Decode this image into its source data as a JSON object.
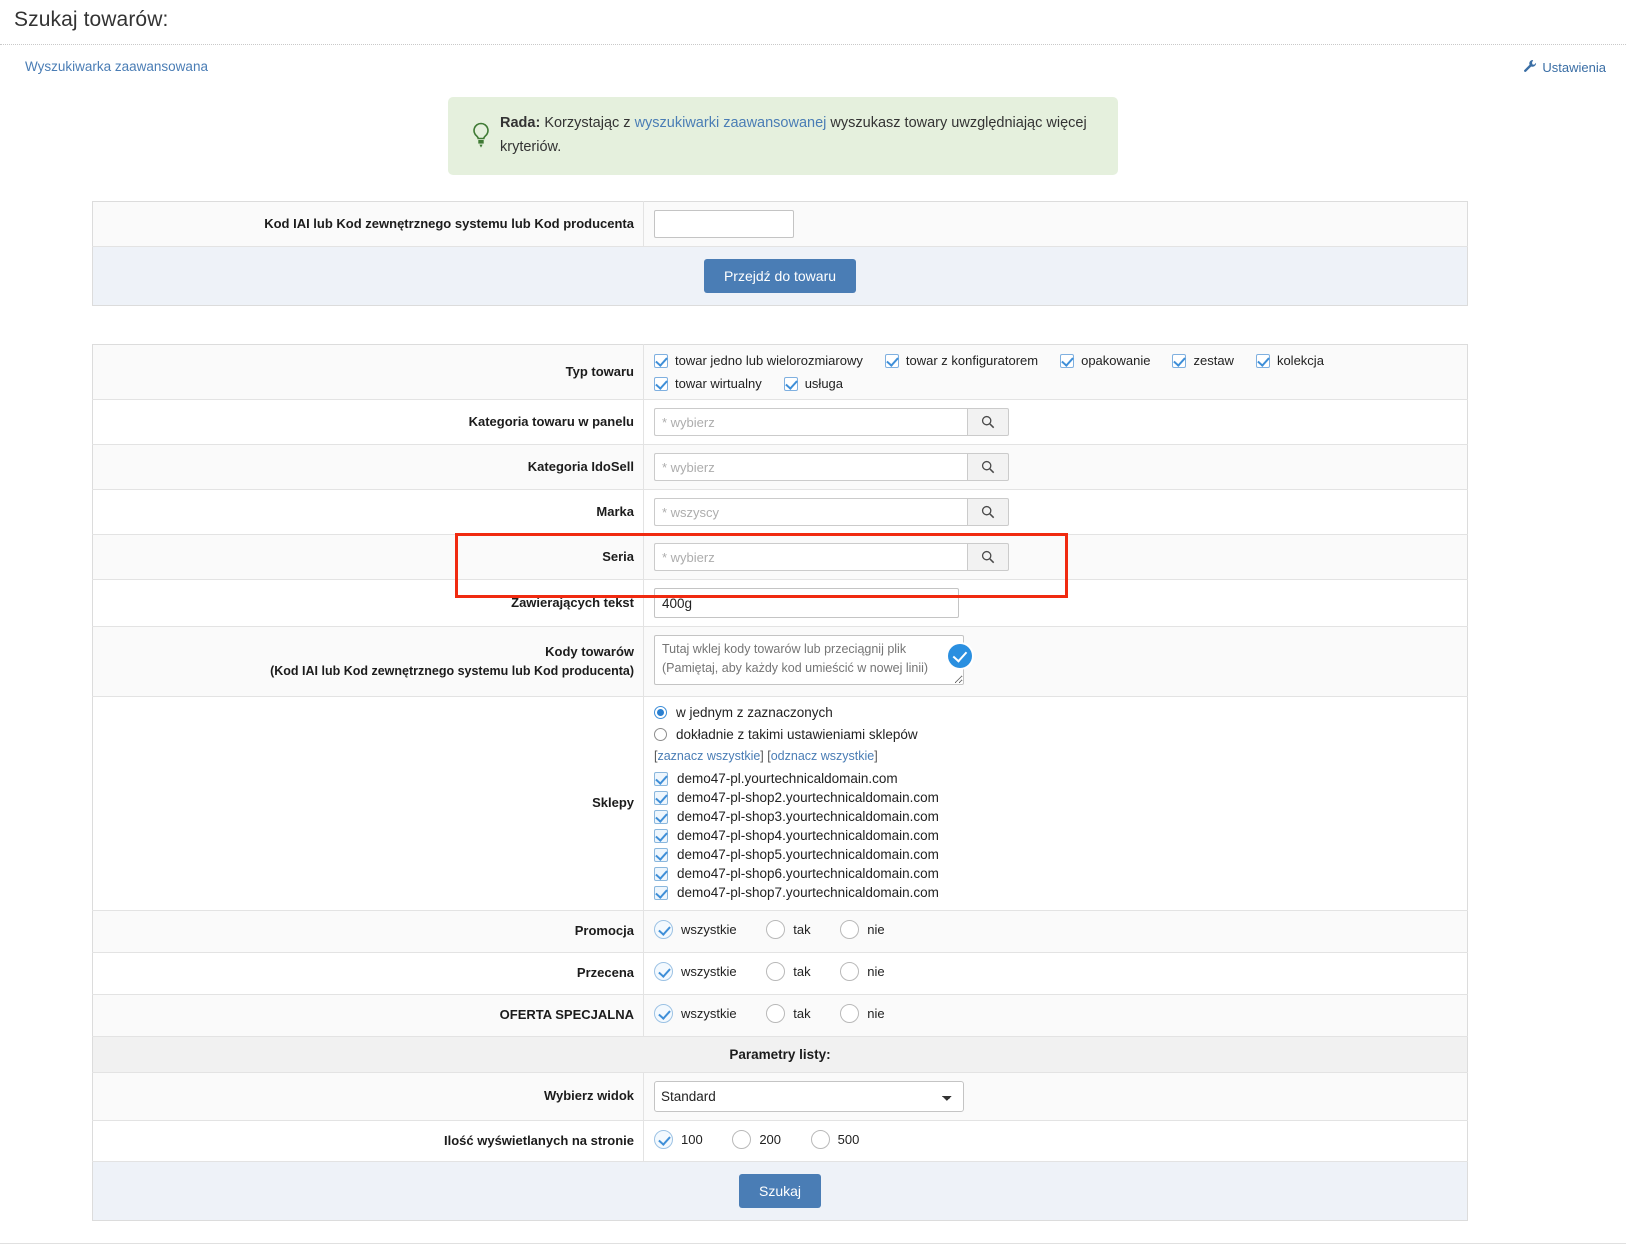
{
  "header": {
    "title": "Szukaj towarów:",
    "advanced_link": "Wyszukiwarka zaawansowana",
    "settings_link": "Ustawienia",
    "settings_icon": "wrench-icon"
  },
  "tip": {
    "icon": "lightbulb-icon",
    "prefix": "Rada:",
    "text_before": " Korzystając z ",
    "link": "wyszukiwarki zaawansowanej",
    "text_after": " wyszukasz towary uwzględniając więcej kryteriów."
  },
  "goto_product": {
    "label": "Kod IAI lub Kod zewnętrznego systemu lub Kod producenta",
    "input_value": "",
    "input_placeholder": "",
    "button": "Przejdź do towaru"
  },
  "form": {
    "typ_towaru": {
      "label": "Typ towaru",
      "options": [
        {
          "label": "towar jedno lub wielorozmiarowy",
          "checked": true
        },
        {
          "label": "towar z konfiguratorem",
          "checked": true
        },
        {
          "label": "opakowanie",
          "checked": true
        },
        {
          "label": "zestaw",
          "checked": true
        },
        {
          "label": "kolekcja",
          "checked": true
        },
        {
          "label": "towar wirtualny",
          "checked": true
        },
        {
          "label": "usługa",
          "checked": true
        }
      ]
    },
    "kategoria_panel": {
      "label": "Kategoria towaru w panelu",
      "placeholder": "* wybierz",
      "value": "",
      "icon": "search-icon"
    },
    "kategoria_idosell": {
      "label": "Kategoria IdoSell",
      "placeholder": "* wybierz",
      "value": "",
      "icon": "search-icon"
    },
    "marka": {
      "label": "Marka",
      "placeholder": "* wszyscy",
      "value": "",
      "icon": "search-icon"
    },
    "seria": {
      "label": "Seria",
      "placeholder": "* wybierz",
      "value": "",
      "icon": "search-icon"
    },
    "zawierajacych_tekst": {
      "label": "Zawierających tekst",
      "value": "400g ",
      "placeholder": "",
      "highlighted": true
    },
    "kody_towarow": {
      "label": "Kody towarów",
      "sublabel": "(Kod IAI lub Kod zewnętrznego systemu lub Kod producenta)",
      "placeholder": "Tutaj wklej kody towarów lub przeciągnij plik\n(Pamiętaj, aby każdy kod umieścić w nowej linii)",
      "value": "",
      "badge_icon": "check-circle-icon"
    },
    "sklepy": {
      "label": "Sklepy",
      "modes": [
        {
          "label": "w jednym z zaznaczonych",
          "selected": true
        },
        {
          "label": "dokładnie z takimi ustawieniami sklepów",
          "selected": false
        }
      ],
      "select_all": "zaznacz wszystkie",
      "deselect_all": "odznacz wszystkie",
      "shops": [
        {
          "label": "demo47-pl.yourtechnicaldomain.com",
          "checked": true
        },
        {
          "label": "demo47-pl-shop2.yourtechnicaldomain.com",
          "checked": true
        },
        {
          "label": "demo47-pl-shop3.yourtechnicaldomain.com",
          "checked": true
        },
        {
          "label": "demo47-pl-shop4.yourtechnicaldomain.com",
          "checked": true
        },
        {
          "label": "demo47-pl-shop5.yourtechnicaldomain.com",
          "checked": true
        },
        {
          "label": "demo47-pl-shop6.yourtechnicaldomain.com",
          "checked": true
        },
        {
          "label": "demo47-pl-shop7.yourtechnicaldomain.com",
          "checked": true
        }
      ]
    },
    "promocja": {
      "label": "Promocja",
      "options": [
        {
          "label": "wszystkie",
          "selected": true
        },
        {
          "label": "tak",
          "selected": false
        },
        {
          "label": "nie",
          "selected": false
        }
      ]
    },
    "przecena": {
      "label": "Przecena",
      "options": [
        {
          "label": "wszystkie",
          "selected": true
        },
        {
          "label": "tak",
          "selected": false
        },
        {
          "label": "nie",
          "selected": false
        }
      ]
    },
    "oferta_specjalna": {
      "label": "OFERTA SPECJALNA",
      "options": [
        {
          "label": "wszystkie",
          "selected": true
        },
        {
          "label": "tak",
          "selected": false
        },
        {
          "label": "nie",
          "selected": false
        }
      ]
    },
    "parametry_header": "Parametry listy:",
    "wybierz_widok": {
      "label": "Wybierz widok",
      "selected": "Standard",
      "options": [
        "Standard"
      ]
    },
    "ilosc_na_stronie": {
      "label": "Ilość wyświetlanych na stronie",
      "options": [
        {
          "label": "100",
          "selected": true
        },
        {
          "label": "200",
          "selected": false
        },
        {
          "label": "500",
          "selected": false
        }
      ]
    },
    "submit": "Szukaj"
  },
  "colors": {
    "accent_blue": "#4a7db5",
    "link_blue": "#4a7db5",
    "tip_green_bg": "#e5f0dd",
    "highlight_red": "#f02a10",
    "badge_blue": "#2a8fe0"
  }
}
